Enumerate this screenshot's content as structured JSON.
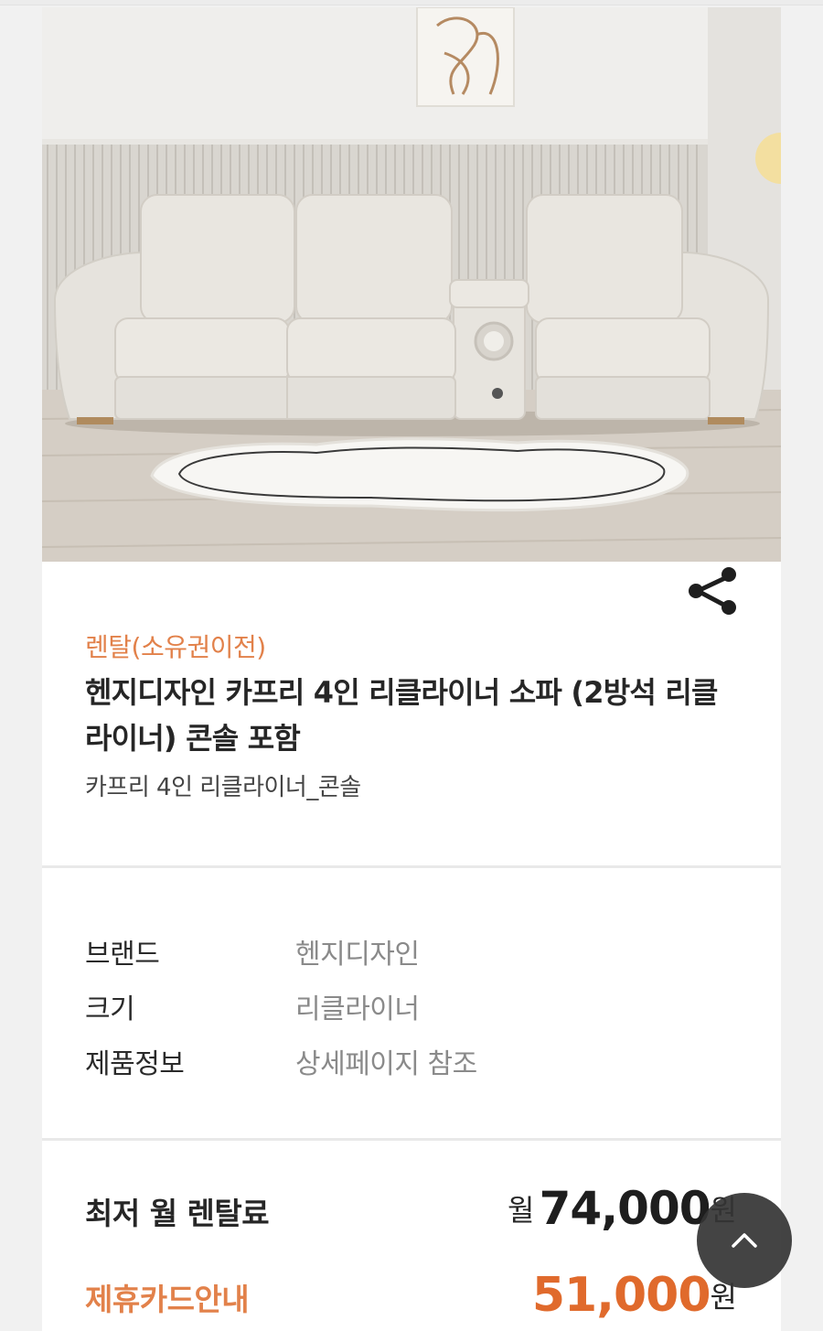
{
  "product": {
    "rent_type": "렌탈(소유권이전)",
    "title": "헨지디자인 카프리 4인 리클라이너 소파 (2방석 리클라이너) 콘솔 포함",
    "subtitle": "카프리 4인 리클라이너_콘솔"
  },
  "specs": [
    {
      "key": "브랜드",
      "value": "헨지디자인"
    },
    {
      "key": "크기",
      "value": "리클라이너"
    },
    {
      "key": "제품정보",
      "value": "상세페이지 참조"
    }
  ],
  "price": {
    "label": "최저 월 렌탈료",
    "prefix": "월",
    "amount": "74,000",
    "unit": "원",
    "card_link": "제휴카드안내",
    "card_amount": "51,000",
    "card_unit": "원"
  },
  "icons": {
    "share": "share-icon",
    "scroll_top": "chevron-up-icon"
  },
  "colors": {
    "accent": "#e2814a",
    "card_price": "#e06a2c",
    "text": "#262626",
    "muted": "#8a8a8a"
  }
}
